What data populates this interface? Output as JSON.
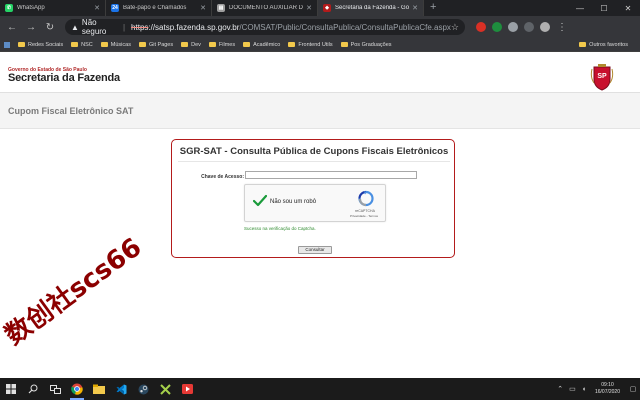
{
  "browser": {
    "tabs": [
      {
        "label": "WhatsApp",
        "icon": "whatsapp-icon",
        "color": "#25d366",
        "active": false
      },
      {
        "label": "Bate-papo e Chamados",
        "icon": "chat-24-icon",
        "color": "#1a73e8",
        "badge": "24",
        "active": false
      },
      {
        "label": "DOCUMENTO AUXILIAR DA NO",
        "icon": "document-icon",
        "color": "#9e9e9e",
        "active": false
      },
      {
        "label": "Secretaria da Fazenda - Governo",
        "icon": "sefaz-favicon",
        "color": "#b31b1b",
        "active": true
      }
    ],
    "new_tab": "+",
    "address": {
      "insecure_label": "Não seguro",
      "url_protocol": "https",
      "url_rest_host": "://satsp.fazenda.sp.gov.br",
      "url_path": "/COMSAT/Public/ConsultaPublica/ConsultaPublicaCfe.aspx"
    },
    "bookmarks": [
      {
        "label": "Redes Sociais"
      },
      {
        "label": "NSC"
      },
      {
        "label": "Músicas"
      },
      {
        "label": "Git Pages"
      },
      {
        "label": "Dev"
      },
      {
        "label": "Filmes"
      },
      {
        "label": "Acadêmico"
      },
      {
        "label": "Frontend Utils"
      },
      {
        "label": "Pos Graduações"
      }
    ],
    "other_bookmarks": "Outros favoritos"
  },
  "header": {
    "gov_label": "Governo do Estado de São Paulo",
    "sec_label": "Secretaria da Fazenda",
    "brasao_text": "SP"
  },
  "subheader": {
    "title": "Cupom Fiscal Eletrônico SAT"
  },
  "form": {
    "title": "SGR-SAT - Consulta Pública de Cupons Fiscais Eletrônicos",
    "key_label": "Chave de Acesso:",
    "key_value": "",
    "captcha_label": "Não sou um robô",
    "captcha_brand": "reCAPTCHA",
    "captcha_links": "Privacidade - Termos",
    "captcha_ok": "Sucesso na verificação do Captcha.",
    "submit_label": "Consultar"
  },
  "watermark": "数创社scs66",
  "taskbar": {
    "time": "09:10",
    "date": "16/07/2020"
  }
}
